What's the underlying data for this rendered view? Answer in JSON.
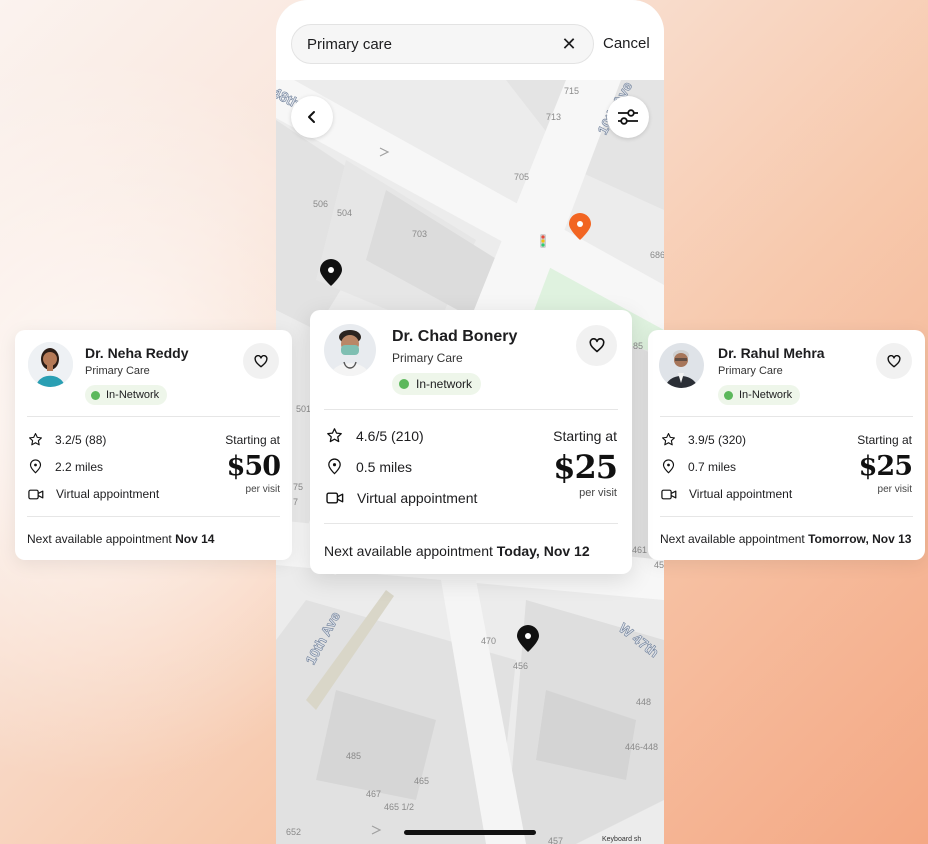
{
  "search": {
    "query": "Primary care",
    "clear_icon": "close-icon",
    "cancel_label": "Cancel"
  },
  "map": {
    "building_numbers": [
      "715",
      "713",
      "705",
      "506",
      "504",
      "703",
      "686",
      "501",
      "485",
      "470",
      "456",
      "448",
      "446-448",
      "465",
      "467",
      "465 1/2",
      "652",
      "457",
      "85",
      "461",
      "45",
      "75",
      "7"
    ],
    "street_labels": [
      "10th Ave",
      "W 47th",
      "10th Ave",
      "48th"
    ],
    "keyboard_label": "Keyboard sh",
    "selected_pin_color": "#f26522",
    "pin_color": "#111111",
    "park_color": "#dff2df"
  },
  "colors": {
    "accent": "#f26522",
    "badge_bg": "#eef6ea",
    "badge_dot": "#5cb85c"
  },
  "doctors": [
    {
      "name": "Dr. Neha Reddy",
      "specialty": "Primary Care",
      "network": "In-Network",
      "rating": "3.2/5 (88)",
      "distance": "2.2 miles",
      "visit_type": "Virtual appointment",
      "starting_label": "Starting at",
      "price": "$50",
      "per_visit": "per visit",
      "next_label": "Next available appointment",
      "next_date": "Nov 14"
    },
    {
      "name": "Dr. Chad Bonery",
      "specialty": "Primary Care",
      "network": "In-network",
      "rating": "4.6/5 (210)",
      "distance": "0.5 miles",
      "visit_type": "Virtual appointment",
      "starting_label": "Starting at",
      "price": "$25",
      "per_visit": "per visit",
      "next_label": "Next available appointment",
      "next_date": "Today, Nov 12"
    },
    {
      "name": "Dr. Rahul Mehra",
      "specialty": "Primary Care",
      "network": "In-Network",
      "rating": "3.9/5 (320)",
      "distance": "0.7 miles",
      "visit_type": "Virtual appointment",
      "starting_label": "Starting at",
      "price": "$25",
      "per_visit": "per visit",
      "next_label": "Next available appointment",
      "next_date": "Tomorrow, Nov 13"
    }
  ]
}
